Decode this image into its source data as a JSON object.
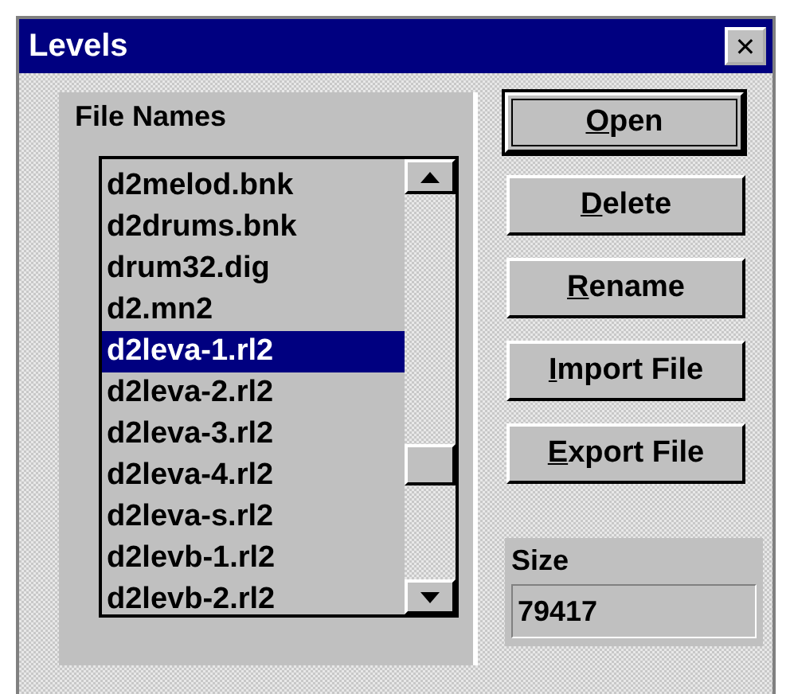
{
  "window": {
    "title": "Levels",
    "close": "✕"
  },
  "file_names": {
    "label": "File Names",
    "items": [
      {
        "name": "d2melod.bnk",
        "selected": false
      },
      {
        "name": "d2drums.bnk",
        "selected": false
      },
      {
        "name": "drum32.dig",
        "selected": false
      },
      {
        "name": "d2.mn2",
        "selected": false
      },
      {
        "name": "d2leva-1.rl2",
        "selected": true
      },
      {
        "name": "d2leva-2.rl2",
        "selected": false
      },
      {
        "name": "d2leva-3.rl2",
        "selected": false
      },
      {
        "name": "d2leva-4.rl2",
        "selected": false
      },
      {
        "name": "d2leva-s.rl2",
        "selected": false
      },
      {
        "name": "d2levb-1.rl2",
        "selected": false
      },
      {
        "name": "d2levb-2.rl2",
        "selected": false
      }
    ]
  },
  "buttons": [
    {
      "label": "Open",
      "default": true
    },
    {
      "label": "Delete",
      "default": false
    },
    {
      "label": "Rename",
      "default": false
    },
    {
      "label": "Import File",
      "default": false
    },
    {
      "label": "Export File",
      "default": false
    }
  ],
  "size": {
    "label": "Size",
    "value": "79417"
  }
}
